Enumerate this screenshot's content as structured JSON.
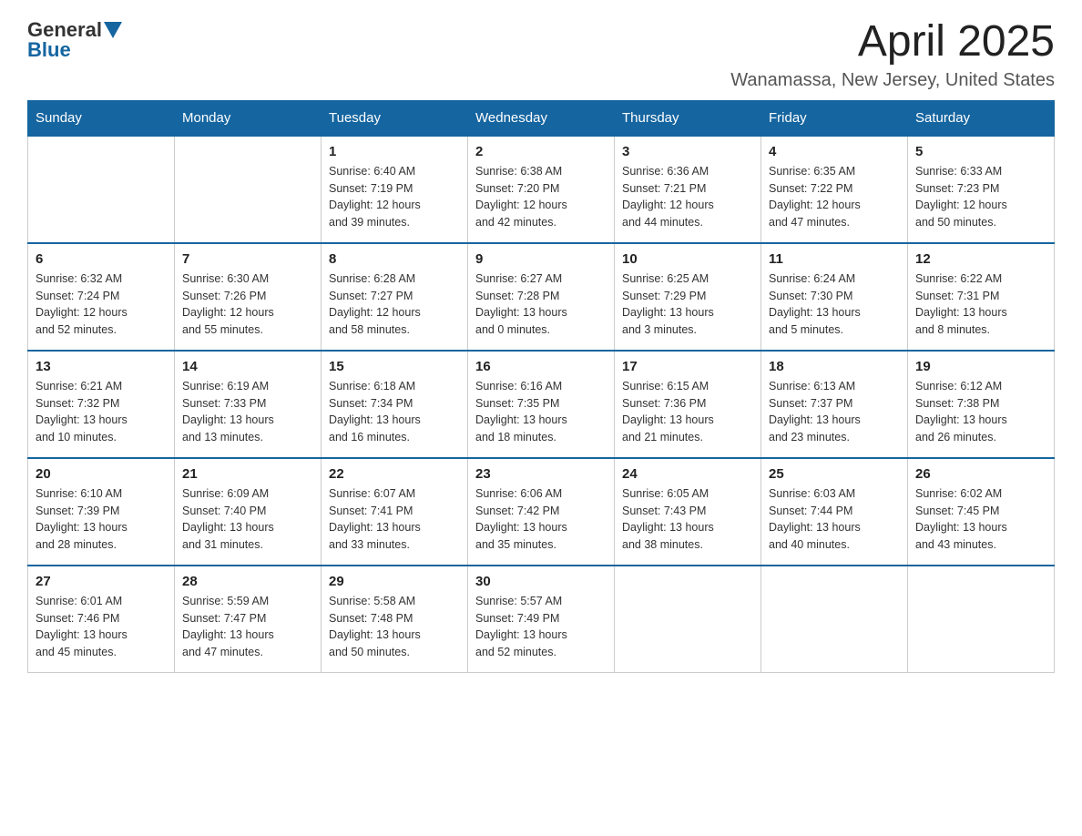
{
  "logo": {
    "general": "General",
    "blue": "Blue"
  },
  "header": {
    "month": "April 2025",
    "location": "Wanamassa, New Jersey, United States"
  },
  "weekdays": [
    "Sunday",
    "Monday",
    "Tuesday",
    "Wednesday",
    "Thursday",
    "Friday",
    "Saturday"
  ],
  "weeks": [
    [
      {
        "day": "",
        "info": ""
      },
      {
        "day": "",
        "info": ""
      },
      {
        "day": "1",
        "info": "Sunrise: 6:40 AM\nSunset: 7:19 PM\nDaylight: 12 hours\nand 39 minutes."
      },
      {
        "day": "2",
        "info": "Sunrise: 6:38 AM\nSunset: 7:20 PM\nDaylight: 12 hours\nand 42 minutes."
      },
      {
        "day": "3",
        "info": "Sunrise: 6:36 AM\nSunset: 7:21 PM\nDaylight: 12 hours\nand 44 minutes."
      },
      {
        "day": "4",
        "info": "Sunrise: 6:35 AM\nSunset: 7:22 PM\nDaylight: 12 hours\nand 47 minutes."
      },
      {
        "day": "5",
        "info": "Sunrise: 6:33 AM\nSunset: 7:23 PM\nDaylight: 12 hours\nand 50 minutes."
      }
    ],
    [
      {
        "day": "6",
        "info": "Sunrise: 6:32 AM\nSunset: 7:24 PM\nDaylight: 12 hours\nand 52 minutes."
      },
      {
        "day": "7",
        "info": "Sunrise: 6:30 AM\nSunset: 7:26 PM\nDaylight: 12 hours\nand 55 minutes."
      },
      {
        "day": "8",
        "info": "Sunrise: 6:28 AM\nSunset: 7:27 PM\nDaylight: 12 hours\nand 58 minutes."
      },
      {
        "day": "9",
        "info": "Sunrise: 6:27 AM\nSunset: 7:28 PM\nDaylight: 13 hours\nand 0 minutes."
      },
      {
        "day": "10",
        "info": "Sunrise: 6:25 AM\nSunset: 7:29 PM\nDaylight: 13 hours\nand 3 minutes."
      },
      {
        "day": "11",
        "info": "Sunrise: 6:24 AM\nSunset: 7:30 PM\nDaylight: 13 hours\nand 5 minutes."
      },
      {
        "day": "12",
        "info": "Sunrise: 6:22 AM\nSunset: 7:31 PM\nDaylight: 13 hours\nand 8 minutes."
      }
    ],
    [
      {
        "day": "13",
        "info": "Sunrise: 6:21 AM\nSunset: 7:32 PM\nDaylight: 13 hours\nand 10 minutes."
      },
      {
        "day": "14",
        "info": "Sunrise: 6:19 AM\nSunset: 7:33 PM\nDaylight: 13 hours\nand 13 minutes."
      },
      {
        "day": "15",
        "info": "Sunrise: 6:18 AM\nSunset: 7:34 PM\nDaylight: 13 hours\nand 16 minutes."
      },
      {
        "day": "16",
        "info": "Sunrise: 6:16 AM\nSunset: 7:35 PM\nDaylight: 13 hours\nand 18 minutes."
      },
      {
        "day": "17",
        "info": "Sunrise: 6:15 AM\nSunset: 7:36 PM\nDaylight: 13 hours\nand 21 minutes."
      },
      {
        "day": "18",
        "info": "Sunrise: 6:13 AM\nSunset: 7:37 PM\nDaylight: 13 hours\nand 23 minutes."
      },
      {
        "day": "19",
        "info": "Sunrise: 6:12 AM\nSunset: 7:38 PM\nDaylight: 13 hours\nand 26 minutes."
      }
    ],
    [
      {
        "day": "20",
        "info": "Sunrise: 6:10 AM\nSunset: 7:39 PM\nDaylight: 13 hours\nand 28 minutes."
      },
      {
        "day": "21",
        "info": "Sunrise: 6:09 AM\nSunset: 7:40 PM\nDaylight: 13 hours\nand 31 minutes."
      },
      {
        "day": "22",
        "info": "Sunrise: 6:07 AM\nSunset: 7:41 PM\nDaylight: 13 hours\nand 33 minutes."
      },
      {
        "day": "23",
        "info": "Sunrise: 6:06 AM\nSunset: 7:42 PM\nDaylight: 13 hours\nand 35 minutes."
      },
      {
        "day": "24",
        "info": "Sunrise: 6:05 AM\nSunset: 7:43 PM\nDaylight: 13 hours\nand 38 minutes."
      },
      {
        "day": "25",
        "info": "Sunrise: 6:03 AM\nSunset: 7:44 PM\nDaylight: 13 hours\nand 40 minutes."
      },
      {
        "day": "26",
        "info": "Sunrise: 6:02 AM\nSunset: 7:45 PM\nDaylight: 13 hours\nand 43 minutes."
      }
    ],
    [
      {
        "day": "27",
        "info": "Sunrise: 6:01 AM\nSunset: 7:46 PM\nDaylight: 13 hours\nand 45 minutes."
      },
      {
        "day": "28",
        "info": "Sunrise: 5:59 AM\nSunset: 7:47 PM\nDaylight: 13 hours\nand 47 minutes."
      },
      {
        "day": "29",
        "info": "Sunrise: 5:58 AM\nSunset: 7:48 PM\nDaylight: 13 hours\nand 50 minutes."
      },
      {
        "day": "30",
        "info": "Sunrise: 5:57 AM\nSunset: 7:49 PM\nDaylight: 13 hours\nand 52 minutes."
      },
      {
        "day": "",
        "info": ""
      },
      {
        "day": "",
        "info": ""
      },
      {
        "day": "",
        "info": ""
      }
    ]
  ]
}
